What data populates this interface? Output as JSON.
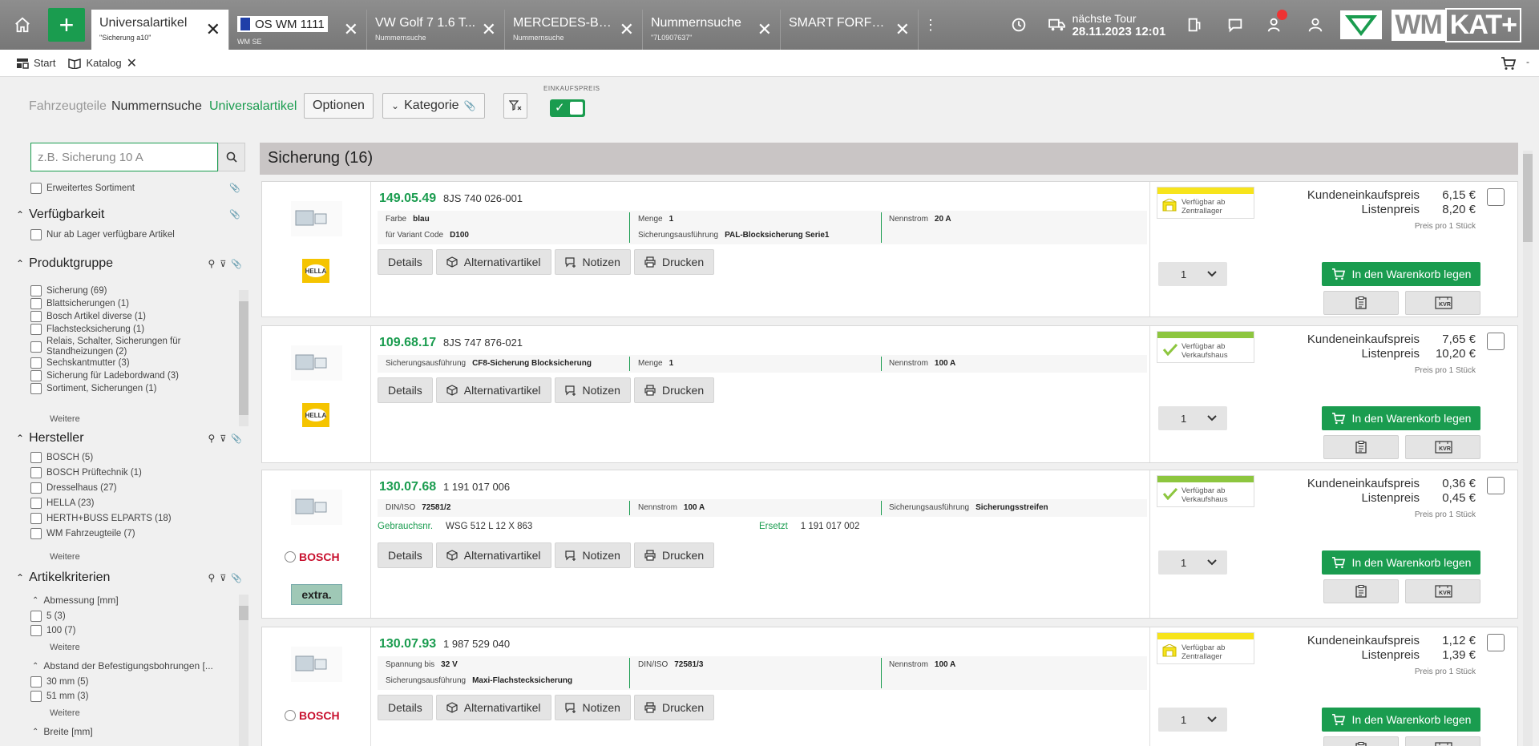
{
  "topbar": {
    "tabs": [
      {
        "title": "Universalartikel",
        "sub": "\"Sicherung a10\"",
        "active": true
      },
      {
        "title": "OS WM 1111",
        "sub": "WM SE",
        "flag": true
      },
      {
        "title": "VW Golf 7 1.6 T...",
        "sub": "Nummernsuche"
      },
      {
        "title": "MERCEDES-BE...",
        "sub": "Nummernsuche"
      },
      {
        "title": "Nummernsuche",
        "sub": "\"7L0907637\""
      },
      {
        "title": "SMART FORFO...",
        "sub": ""
      }
    ],
    "tour_label": "nächste Tour",
    "tour_date": "28.11.2023 12:01",
    "brand_wm": "WM",
    "brand_kat": "KAT+"
  },
  "subbar": {
    "start_label": "Start",
    "katalog_label": "Katalog",
    "dash": "-"
  },
  "filterbar": {
    "fahrzeugteile": "Fahrzeugteile",
    "nummernsuche": "Nummernsuche",
    "universalartikel": "Universalartikel",
    "optionen": "Optionen",
    "kategorie": "Kategorie",
    "einkaufspreis": "EINKAUFSPREIS"
  },
  "sidebar": {
    "search_placeholder": "z.B. Sicherung 10 A",
    "erweitertes": "Erweitertes Sortiment",
    "verfuegbarkeit_title": "Verfügbarkeit",
    "nur_lager": "Nur ab Lager verfügbare Artikel",
    "produktgruppe_title": "Produktgruppe",
    "produktgruppe": [
      "Sicherung (69)",
      "Blattsicherungen (1)",
      "Bosch Artikel diverse (1)",
      "Flachstecksicherung (1)",
      "Relais, Schalter, Sicherungen für Standheizungen (2)",
      "Sechskantmutter (3)",
      "Sicherung für Ladebordwand (3)",
      "Sortiment, Sicherungen (1)"
    ],
    "weitere": "Weitere",
    "hersteller_title": "Hersteller",
    "hersteller": [
      "BOSCH (5)",
      "BOSCH Prüftechnik (1)",
      "Dresselhaus (27)",
      "HELLA (23)",
      "HERTH+BUSS ELPARTS (18)",
      "WM Fahrzeugteile (7)"
    ],
    "artikelkriterien_title": "Artikelkriterien",
    "abmessung_title": "Abmessung [mm]",
    "abmessung": [
      "5 (3)",
      "100 (7)"
    ],
    "abstand_title": "Abstand der Befestigungsbohrungen [...",
    "abstand": [
      "30 mm (5)",
      "51 mm (3)"
    ],
    "breite_title": "Breite [mm]"
  },
  "results": {
    "header": "Sicherung (16)",
    "actions": {
      "details": "Details",
      "alternativ": "Alternativartikel",
      "notizen": "Notizen",
      "drucken": "Drucken",
      "cart": "In den Warenkorb legen",
      "kundenek": "Kundeneinkaufspreis",
      "listenpreis": "Listenpreis",
      "unit": "Preis pro 1 Stück",
      "kvr": "KVR"
    },
    "items": [
      {
        "artno": "149.05.49",
        "oe": "8JS 740 026-001",
        "attrs": [
          {
            "label": "Farbe",
            "value": "blau"
          },
          {
            "label": "Menge",
            "value": "1"
          },
          {
            "label": "Nennstrom",
            "value": "20 A"
          },
          {
            "label": "für Variant Code",
            "value": "D100"
          },
          {
            "label": "Sicherungsausführung",
            "value": "PAL-Blocksicherung Serie1"
          }
        ],
        "avail": "Verfügbar ab Zentrallager",
        "qty": "1",
        "kundenek": "6,15 €",
        "listen": "8,20 €",
        "brand": "HELLA"
      },
      {
        "artno": "109.68.17",
        "oe": "8JS 747 876-021",
        "attrs": [
          {
            "label": "Sicherungsausführung",
            "value": "CF8-Sicherung   Blocksicherung"
          },
          {
            "label": "Menge",
            "value": "1"
          },
          {
            "label": "Nennstrom",
            "value": "100 A"
          }
        ],
        "avail": "Verfügbar ab Verkaufshaus",
        "qty": "1",
        "kundenek": "7,65 €",
        "listen": "10,20 €",
        "brand": "HELLA"
      },
      {
        "artno": "130.07.68",
        "oe": "1 191 017 006",
        "attrs": [
          {
            "label": "DIN/ISO",
            "value": "72581/2"
          },
          {
            "label": "Nennstrom",
            "value": "100 A"
          },
          {
            "label": "Sicherungsausführung",
            "value": "Sicherungsstreifen"
          }
        ],
        "gebrauch_label": "Gebrauchsnr.",
        "gebrauch_value": "WSG 512 L 12 X 863",
        "ersetzt_label": "Ersetzt",
        "ersetzt_value": "1 191 017 002",
        "avail": "Verfügbar ab Verkaufshaus",
        "qty": "1",
        "kundenek": "0,36 €",
        "listen": "0,45 €",
        "brand": "BOSCH",
        "brand2": "extra."
      },
      {
        "artno": "130.07.93",
        "oe": "1 987 529 040",
        "attrs": [
          {
            "label": "Spannung bis",
            "value": "32 V"
          },
          {
            "label": "DIN/ISO",
            "value": "72581/3"
          },
          {
            "label": "Nennstrom",
            "value": "100 A"
          },
          {
            "label": "Sicherungsausführung",
            "value": "Maxi-Flachstecksicherung"
          }
        ],
        "avail": "Verfügbar ab Zentrallager",
        "qty": "1",
        "kundenek": "1,12 €",
        "listen": "1,39 €",
        "brand": "BOSCH"
      }
    ]
  },
  "colors": {
    "accent": "#1a9c4f",
    "yellow": "#f7e41b",
    "limegreen": "#8dc63f"
  }
}
